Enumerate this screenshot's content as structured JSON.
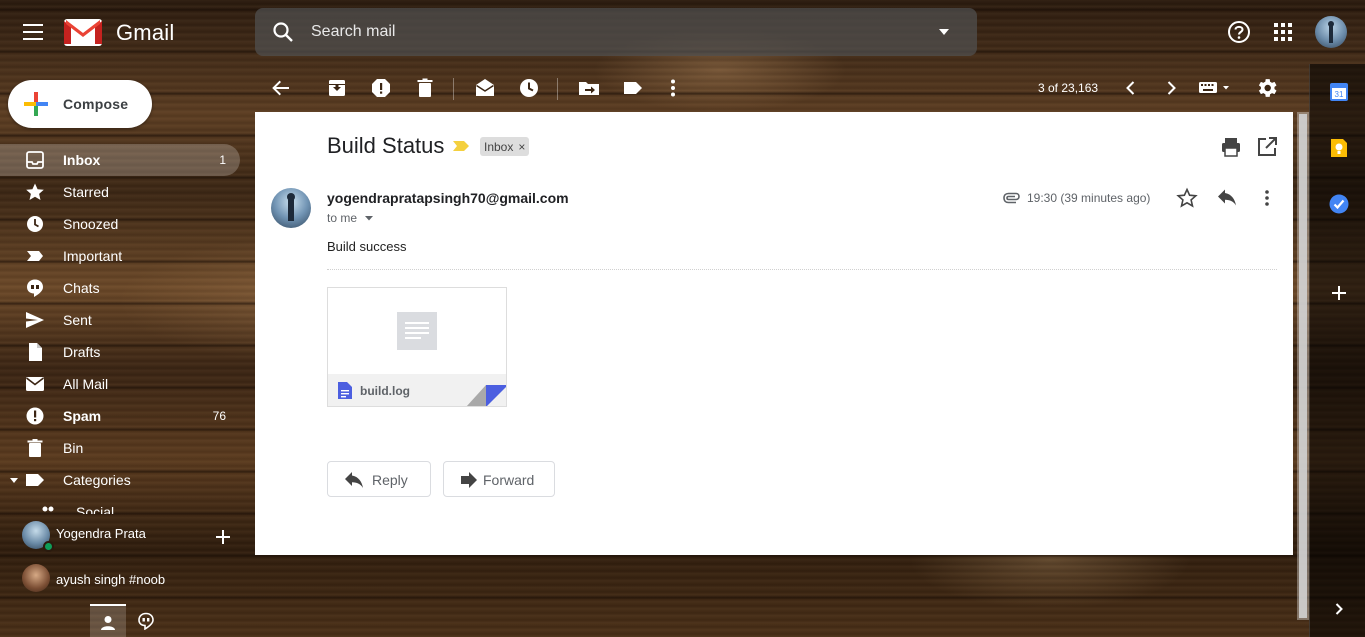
{
  "header": {
    "app_name": "Gmail",
    "search_placeholder": "Search mail"
  },
  "compose_label": "Compose",
  "nav": {
    "items": [
      {
        "label": "Inbox",
        "count": "1",
        "icon": "inbox-icon",
        "active": true,
        "bold": true
      },
      {
        "label": "Starred",
        "count": "",
        "icon": "star-icon"
      },
      {
        "label": "Snoozed",
        "count": "",
        "icon": "clock-icon"
      },
      {
        "label": "Important",
        "count": "",
        "icon": "important-icon"
      },
      {
        "label": "Chats",
        "count": "",
        "icon": "chat-icon"
      },
      {
        "label": "Sent",
        "count": "",
        "icon": "send-icon"
      },
      {
        "label": "Drafts",
        "count": "",
        "icon": "draft-icon"
      },
      {
        "label": "All Mail",
        "count": "",
        "icon": "mail-icon"
      },
      {
        "label": "Spam",
        "count": "76",
        "icon": "spam-icon",
        "bold": true
      },
      {
        "label": "Bin",
        "count": "",
        "icon": "trash-icon"
      },
      {
        "label": "Categories",
        "count": "",
        "icon": "label-icon",
        "expandable": true
      }
    ],
    "partial_item": "Social"
  },
  "hangouts": {
    "self_name": "Yogendra Prata",
    "contacts": [
      "ayush singh #noob"
    ]
  },
  "toolbar": {
    "page_count": "3 of 23,163"
  },
  "email": {
    "subject": "Build Status",
    "label": "Inbox",
    "label_remove": "×",
    "sender": "yogendrapratapsingh70@gmail.com",
    "recipient": "to me",
    "timestamp": "19:30 (39 minutes ago)",
    "body": "Build success",
    "attachment": {
      "name": "build.log",
      "icon": "document-icon"
    },
    "reply_label": "Reply",
    "forward_label": "Forward"
  },
  "colors": {
    "calendar_blue": "#4285f4",
    "keep_yellow": "#fbbc04",
    "tasks_blue": "#4285f4",
    "important_yellow": "#f4d03f",
    "online_green": "#0f9d58",
    "attachment_blue": "#4c5fe0"
  },
  "side_panel": {
    "calendar_day": "31"
  }
}
